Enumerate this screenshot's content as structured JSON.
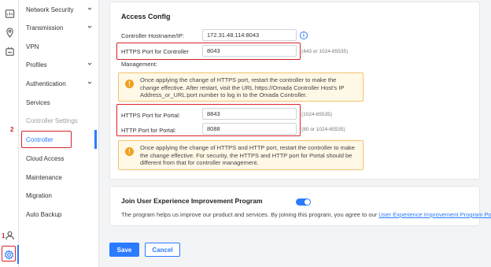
{
  "rail": {
    "icons": [
      "dashboard-icon",
      "location-icon",
      "devices-icon",
      "user-icon",
      "settings-icon"
    ],
    "annotation_numbers": [
      "1",
      "2"
    ]
  },
  "nav": {
    "items": [
      {
        "label": "Network Security",
        "chevron": true
      },
      {
        "label": "Transmission",
        "chevron": true
      },
      {
        "label": "VPN",
        "chevron": false
      },
      {
        "label": "Profiles",
        "chevron": true
      },
      {
        "label": "Authentication",
        "chevron": true
      },
      {
        "label": "Services",
        "chevron": false
      },
      {
        "label": "Controller Settings",
        "chevron": false
      },
      {
        "label": "Controller",
        "chevron": false
      },
      {
        "label": "Cloud Access",
        "chevron": false
      },
      {
        "label": "Maintenance",
        "chevron": false
      },
      {
        "label": "Migration",
        "chevron": false
      },
      {
        "label": "Auto Backup",
        "chevron": false
      }
    ]
  },
  "access": {
    "title": "Access Config",
    "hostname_label": "Controller Hostname/IP:",
    "hostname_value": "172.31.48.114:8043",
    "https_ctrl_label": "HTTPS Port for Controller",
    "https_ctrl_value": "8043",
    "https_ctrl_hint": "(443 or 1024-65535)",
    "management_label": "Management:",
    "warn1": "Once applying the change of HTTPS port, restart the controller to make the change effective. After restart, visit the URL https://Omada Controller Host's IP Address_or_URL:port number to log in to the Omada Controller.",
    "https_portal_label": "HTTPS Port for Portal:",
    "https_portal_value": "8843",
    "https_portal_hint": "(1024-65535)",
    "http_portal_label": "HTTP Port for Portal:",
    "http_portal_value": "8088",
    "http_portal_hint": "(80 or 1024-65535)",
    "warn2": "Once applying the change of HTTPS and HTTP port, restart the controller to make the change effective. For security, the HTTPS and HTTP port for Portal should be different from that for controller management."
  },
  "improve": {
    "title": "Join User Experience Improvement Program",
    "enabled": true,
    "desc": "The program helps us improve our product and services. By joining this program, you agree to our ",
    "link": "User Experience Improvement Program Policy",
    "desc_end": "."
  },
  "actions": {
    "save": "Save",
    "cancel": "Cancel"
  },
  "colors": {
    "accent": "#2b7bff",
    "highlight": "#d8232a",
    "warning_bg": "#fff8e6"
  }
}
